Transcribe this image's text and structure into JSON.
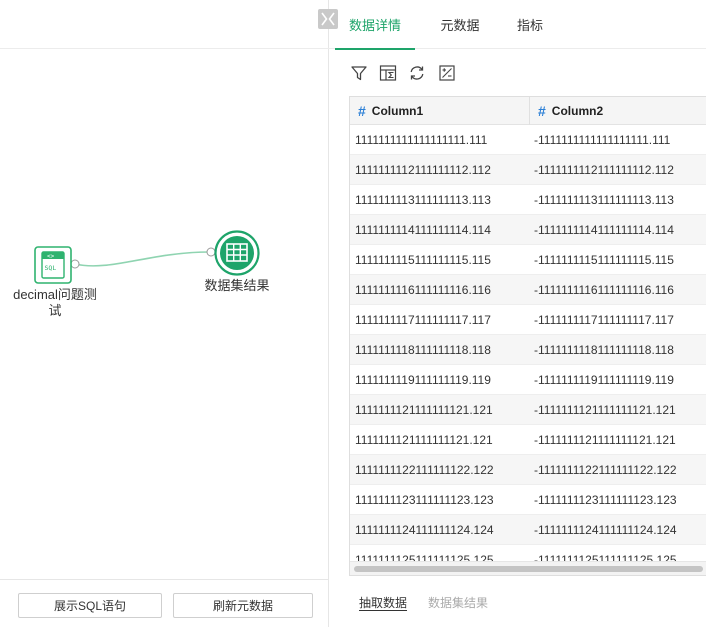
{
  "colors": {
    "accent": "#1ea46a",
    "hash": "#2b7fd6"
  },
  "flow": {
    "sql_node": {
      "label": "decimal问题测试",
      "icon": "sql-node-icon",
      "badge": "SQL"
    },
    "result_node": {
      "label": "数据集结果",
      "icon": "table-node-icon"
    }
  },
  "footer": {
    "show_sql": "展示SQL语句",
    "refresh_meta": "刷新元数据"
  },
  "tabs": [
    {
      "label": "数据详情",
      "active": true
    },
    {
      "label": "元数据",
      "active": false
    },
    {
      "label": "指标",
      "active": false
    }
  ],
  "toolbar": [
    "filter-icon",
    "formula-column-icon",
    "refresh-icon",
    "calculate-icon"
  ],
  "table": {
    "columns": [
      {
        "type_icon": "#",
        "name": "Column1"
      },
      {
        "type_icon": "#",
        "name": "Column2"
      }
    ],
    "rows": [
      [
        "1111111111111111111.111",
        "-1111111111111111111.111"
      ],
      [
        "1111111112111111112.112",
        "-1111111112111111112.112"
      ],
      [
        "1111111113111111113.113",
        "-1111111113111111113.113"
      ],
      [
        "1111111114111111114.114",
        "-1111111114111111114.114"
      ],
      [
        "1111111115111111115.115",
        "-1111111115111111115.115"
      ],
      [
        "1111111116111111116.116",
        "-1111111116111111116.116"
      ],
      [
        "1111111117111111117.117",
        "-1111111117111111117.117"
      ],
      [
        "1111111118111111118.118",
        "-1111111118111111118.118"
      ],
      [
        "1111111119111111119.119",
        "-1111111119111111119.119"
      ],
      [
        "1111111121111111121.121",
        "-1111111121111111121.121"
      ],
      [
        "1111111121111111121.121",
        "-1111111121111111121.121"
      ],
      [
        "1111111122111111122.122",
        "-1111111122111111122.122"
      ],
      [
        "1111111123111111123.123",
        "-1111111123111111123.123"
      ],
      [
        "1111111124111111124.124",
        "-1111111124111111124.124"
      ],
      [
        "1111111125111111125.125",
        "-1111111125111111125.125"
      ]
    ]
  },
  "bottom_tabs": [
    {
      "label": "抽取数据",
      "active": true
    },
    {
      "label": "数据集结果",
      "active": false
    }
  ]
}
